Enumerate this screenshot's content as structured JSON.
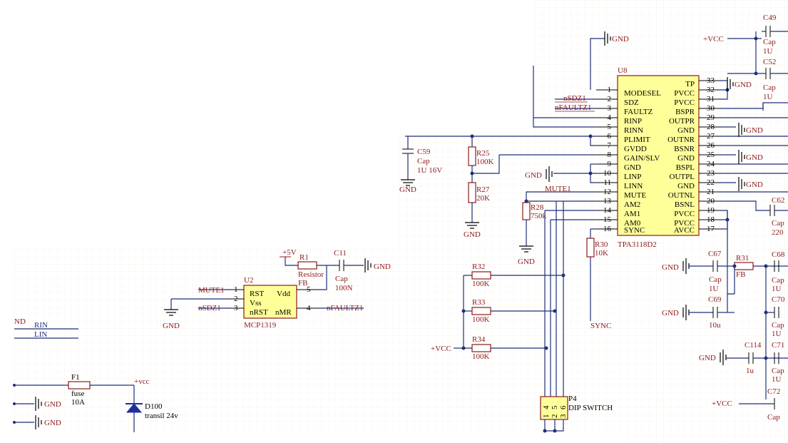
{
  "u8": {
    "ref": "U8",
    "part": "TPA3118D2",
    "left_pins": [
      {
        "num": "1",
        "name": "MODESEL"
      },
      {
        "num": "2",
        "name": "SDZ"
      },
      {
        "num": "3",
        "name": "FAULTZ"
      },
      {
        "num": "4",
        "name": "RINP"
      },
      {
        "num": "5",
        "name": "RINN"
      },
      {
        "num": "6",
        "name": "PLIMIT"
      },
      {
        "num": "7",
        "name": "GVDD"
      },
      {
        "num": "8",
        "name": "GAIN/SLV"
      },
      {
        "num": "9",
        "name": "GND"
      },
      {
        "num": "10",
        "name": "LINP"
      },
      {
        "num": "11",
        "name": "LINN"
      },
      {
        "num": "12",
        "name": "MUTE"
      },
      {
        "num": "13",
        "name": "AM2"
      },
      {
        "num": "14",
        "name": "AM1"
      },
      {
        "num": "15",
        "name": "AM0"
      },
      {
        "num": "16",
        "name": "SYNC"
      }
    ],
    "right_pins": [
      {
        "num": "33",
        "name": "TP"
      },
      {
        "num": "32",
        "name": "PVCC"
      },
      {
        "num": "31",
        "name": "PVCC"
      },
      {
        "num": "30",
        "name": "BSPR"
      },
      {
        "num": "29",
        "name": "OUTPR"
      },
      {
        "num": "28",
        "name": "GND"
      },
      {
        "num": "27",
        "name": "OUTNR"
      },
      {
        "num": "26",
        "name": "BSNR"
      },
      {
        "num": "25",
        "name": "GND"
      },
      {
        "num": "24",
        "name": "BSPL"
      },
      {
        "num": "23",
        "name": "OUTPL"
      },
      {
        "num": "22",
        "name": "GND"
      },
      {
        "num": "21",
        "name": "OUTNL"
      },
      {
        "num": "20",
        "name": "BSNL"
      },
      {
        "num": "19",
        "name": "PVCC"
      },
      {
        "num": "18",
        "name": "PVCC"
      },
      {
        "num": "17",
        "name": "AVCC"
      }
    ]
  },
  "u2": {
    "ref": "U2",
    "part": "MCP1319",
    "pins": [
      {
        "num": "1",
        "name": "RST"
      },
      {
        "num": "2",
        "name": "Vss"
      },
      {
        "num": "3",
        "name": "nRST"
      },
      {
        "num": "4",
        "name": "nMR"
      },
      {
        "num": "5",
        "name": "Vdd"
      }
    ]
  },
  "nets": {
    "gnd": "GND",
    "vcc": "+VCC",
    "vcc_lower": "+vcc",
    "v5": "+5V",
    "nsdz1": "nSDZ1",
    "nfaultz1": "nFAULTZ1",
    "mute1": "MUTE1",
    "sync": "SYNC",
    "rin": "RIN",
    "lin": "LIN",
    "gnd_partial": "ND"
  },
  "components": {
    "c49": {
      "ref": "C49",
      "type": "Cap",
      "value": "1U"
    },
    "c52": {
      "ref": "C52",
      "type": "Cap",
      "value": "1U"
    },
    "c59": {
      "ref": "C59",
      "type": "Cap",
      "value": "1U 16V"
    },
    "r25": {
      "ref": "R25",
      "value": "100K"
    },
    "r27": {
      "ref": "R27",
      "value": "20K"
    },
    "r28": {
      "ref": "R28",
      "value": "750k"
    },
    "r30": {
      "ref": "R30",
      "value": "10K"
    },
    "r32": {
      "ref": "R32",
      "value": "100K"
    },
    "r33": {
      "ref": "R33",
      "value": "100K"
    },
    "r34": {
      "ref": "R34",
      "value": "100K"
    },
    "r1": {
      "ref": "R1",
      "type": "Resistor",
      "value": "FB"
    },
    "c11": {
      "ref": "C11",
      "type": "Cap",
      "value": "100N"
    },
    "c67": {
      "ref": "C67",
      "type": "Cap",
      "value": "1U"
    },
    "c69": {
      "ref": "C69",
      "value": "10u"
    },
    "r31": {
      "ref": "R31",
      "value": "FB"
    },
    "c114": {
      "ref": "C114",
      "value": "1u"
    },
    "c62": {
      "ref": "C62",
      "type": "Cap",
      "value": "220"
    },
    "c68": {
      "ref": "C68",
      "type": "Cap",
      "value": "1U"
    },
    "c70": {
      "ref": "C70",
      "type": "Cap",
      "value": "1U"
    },
    "c71": {
      "ref": "C71",
      "type": "Cap",
      "value": "1U"
    },
    "c72": {
      "ref": "C72",
      "type": "Cap"
    },
    "f1": {
      "ref": "F1",
      "type": "fuse",
      "value": "10A"
    },
    "d100": {
      "ref": "D100",
      "value": "transil 24v"
    },
    "p4": {
      "ref": "P4",
      "value": "DIP SWITCH",
      "pins": [
        "1",
        "2",
        "3",
        "4",
        "5",
        "6"
      ]
    }
  }
}
